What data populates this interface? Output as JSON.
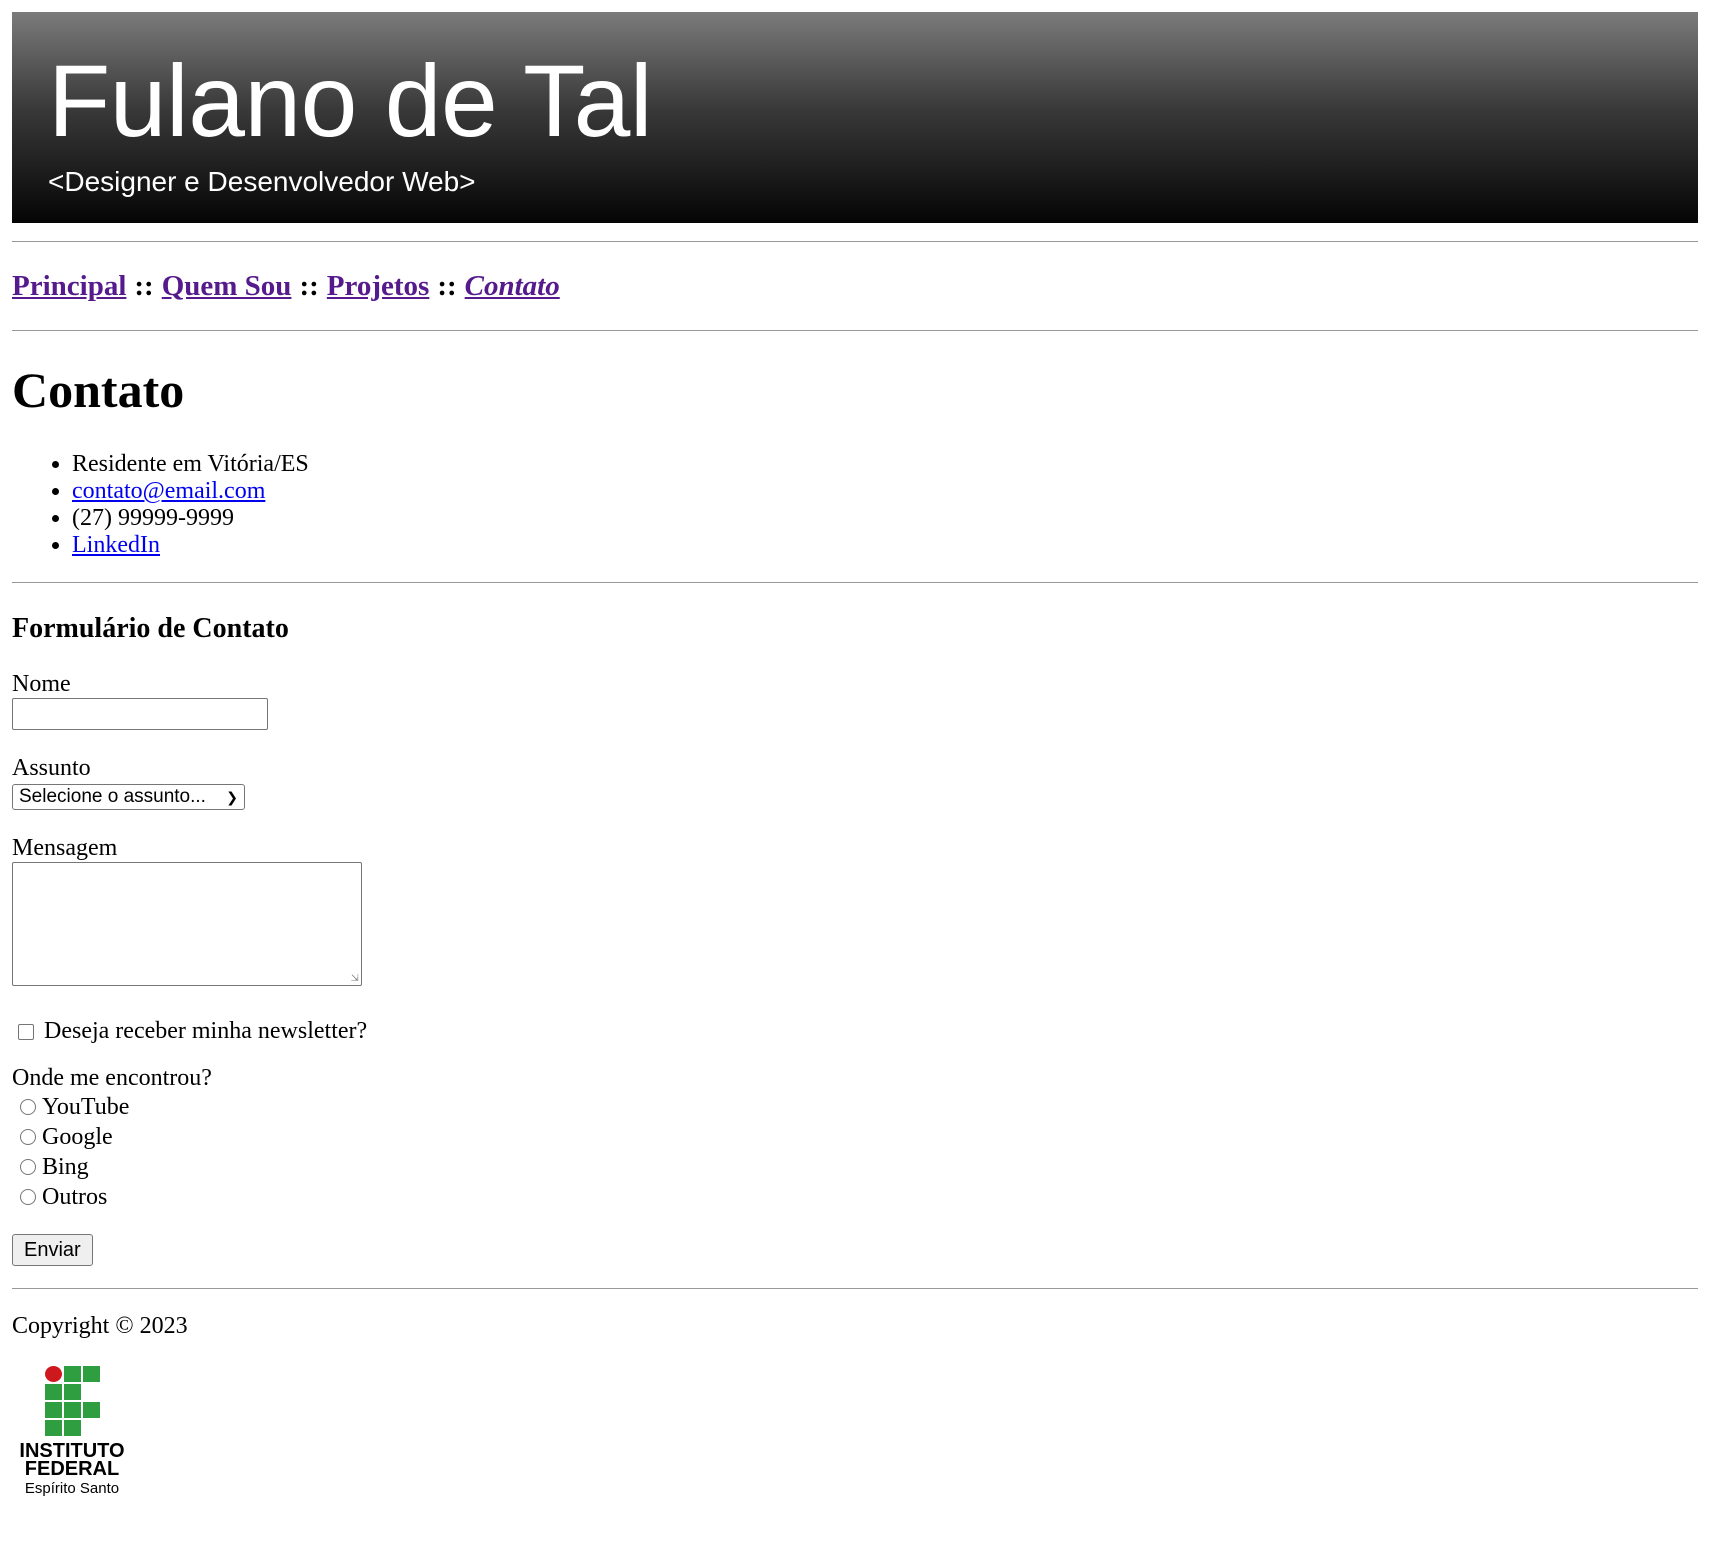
{
  "header": {
    "name": "Fulano de Tal",
    "role": "<Designer e Desenvolvedor Web>"
  },
  "nav": {
    "items": [
      "Principal",
      "Quem Sou",
      "Projetos",
      "Contato"
    ],
    "separator": "::",
    "current": "Contato"
  },
  "main": {
    "title": "Contato",
    "info": {
      "residence": "Residente em Vitória/ES",
      "email": "contato@email.com",
      "phone": "(27) 99999-9999",
      "linkedin": "LinkedIn"
    }
  },
  "form": {
    "title": "Formulário de Contato",
    "name_label": "Nome",
    "name_value": "",
    "subject_label": "Assunto",
    "subject_selected": "Selecione o assunto...",
    "message_label": "Mensagem",
    "message_value": "",
    "newsletter_label": "Deseja receber minha newsletter?",
    "newsletter_checked": false,
    "source_label": "Onde me encontrou?",
    "source_options": [
      "YouTube",
      "Google",
      "Bing",
      "Outros"
    ],
    "submit_label": "Enviar"
  },
  "footer": {
    "copyright": "Copyright © 2023",
    "logo": {
      "line1": "INSTITUTO",
      "line2": "FEDERAL",
      "line3": "Espírito Santo",
      "colors": {
        "green": "#2f9e41",
        "red": "#cd191e"
      }
    }
  }
}
